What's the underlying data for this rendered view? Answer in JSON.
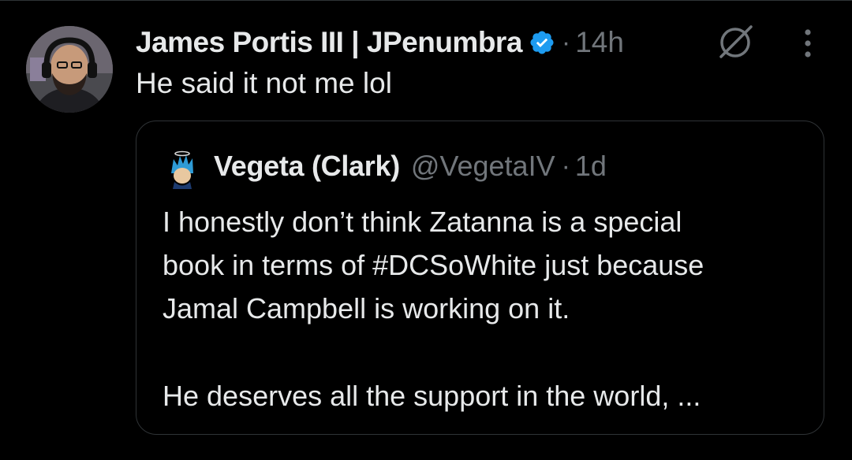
{
  "post": {
    "author_name": "James Portis III | JPenumbra",
    "separator": "·",
    "time": "14h",
    "text": "He said it not me lol",
    "icons": {
      "avatar": "avatar",
      "verified": "verified-badge-icon",
      "grok": "grok-icon",
      "more": "more-options-icon"
    },
    "colors": {
      "verified": "#1d9bf0",
      "muted_text": "#71767b",
      "primary_text": "#e7e9ea",
      "background": "#000000",
      "border": "#2f3336"
    }
  },
  "quote": {
    "author_name": "Vegeta (Clark)",
    "handle": "@VegetaIV",
    "separator": "·",
    "time": "1d",
    "lines": [
      "I honestly don’t think Zatanna is a special",
      "book in terms of #DCSoWhite just because",
      "Jamal Campbell is working on it.",
      "He deserves all the support in the world, ..."
    ]
  }
}
